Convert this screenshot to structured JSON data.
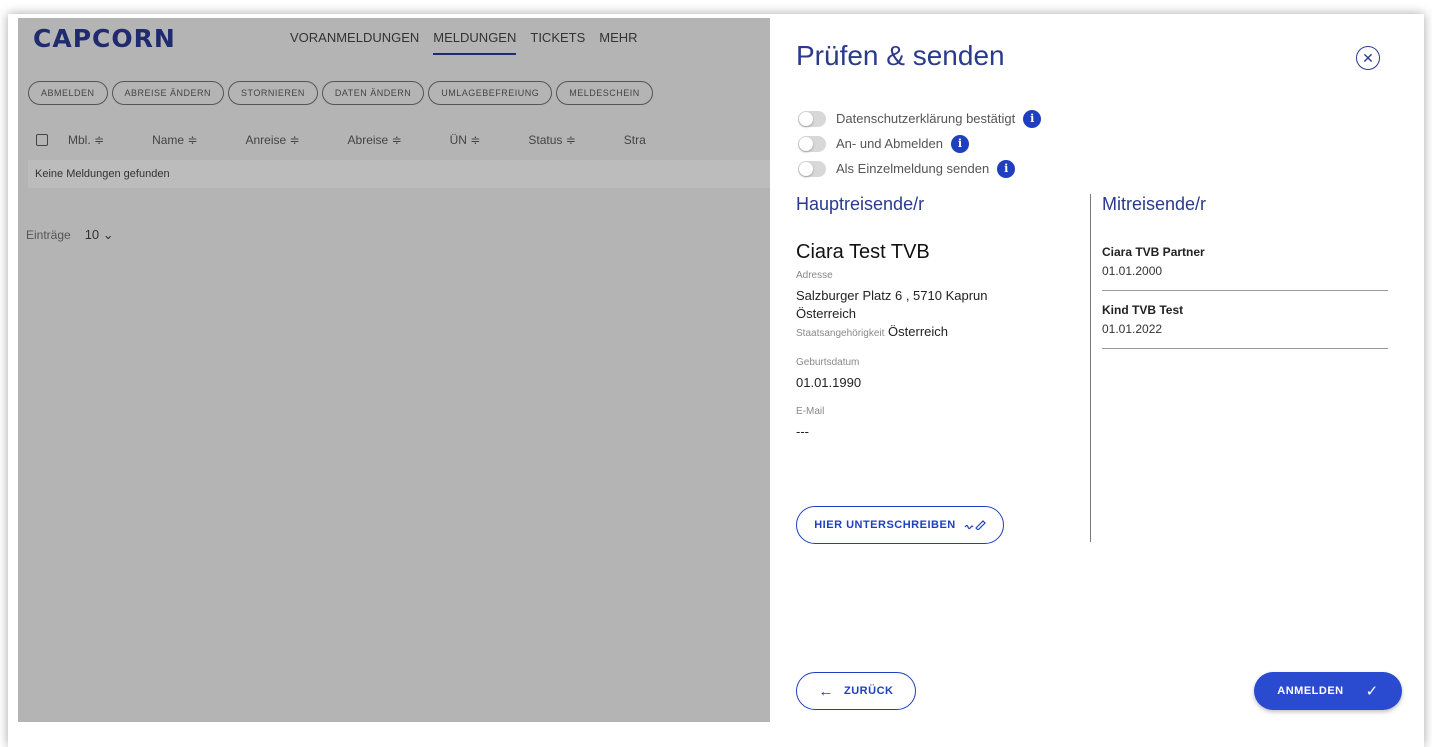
{
  "app": {
    "logo": "CAPCORN",
    "nav": [
      "VORANMELDUNGEN",
      "MELDUNGEN",
      "TICKETS",
      "MEHR"
    ],
    "nav_active": "MELDUNGEN",
    "actions": [
      "ABMELDEN",
      "ABREISE ÄNDERN",
      "STORNIEREN",
      "DATEN ÄNDERN",
      "UMLAGEBEFREIUNG",
      "MELDESCHEIN"
    ],
    "columns": [
      "Mbl. ≑",
      "Name ≑",
      "Anreise ≑",
      "Abreise ≑",
      "ÜN ≑",
      "Status ≑",
      "Stra"
    ],
    "empty_message": "Keine Meldungen gefunden",
    "entries_label": "Einträge",
    "entries_value": "10"
  },
  "panel": {
    "title": "Prüfen & senden",
    "toggles": [
      {
        "label": "Datenschutzerklärung bestätigt",
        "info": "i"
      },
      {
        "label": "An- und Abmelden",
        "info": "i"
      },
      {
        "label": "Als Einzelmeldung senden",
        "info": "i"
      }
    ],
    "main": {
      "section_title": "Hauptreisende/r",
      "name": "Ciara Test TVB",
      "address_label": "Adresse",
      "address_line1": "Salzburger Platz 6 , 5710 Kaprun",
      "address_line2": "Österreich",
      "nationality_label": "Staatsangehörigkeit",
      "nationality_value": "Österreich",
      "birthdate_label": "Geburtsdatum",
      "birthdate_value": "01.01.1990",
      "email_label": "E-Mail",
      "email_value": "---",
      "sign_label": "HIER UNTERSCHREIBEN"
    },
    "companions": {
      "section_title": "Mitreisende/r",
      "items": [
        {
          "name": "Ciara TVB Partner",
          "date": "01.01.2000"
        },
        {
          "name": "Kind TVB Test",
          "date": "01.01.2022"
        }
      ]
    },
    "back_label": "ZURÜCK",
    "submit_label": "ANMELDEN"
  }
}
